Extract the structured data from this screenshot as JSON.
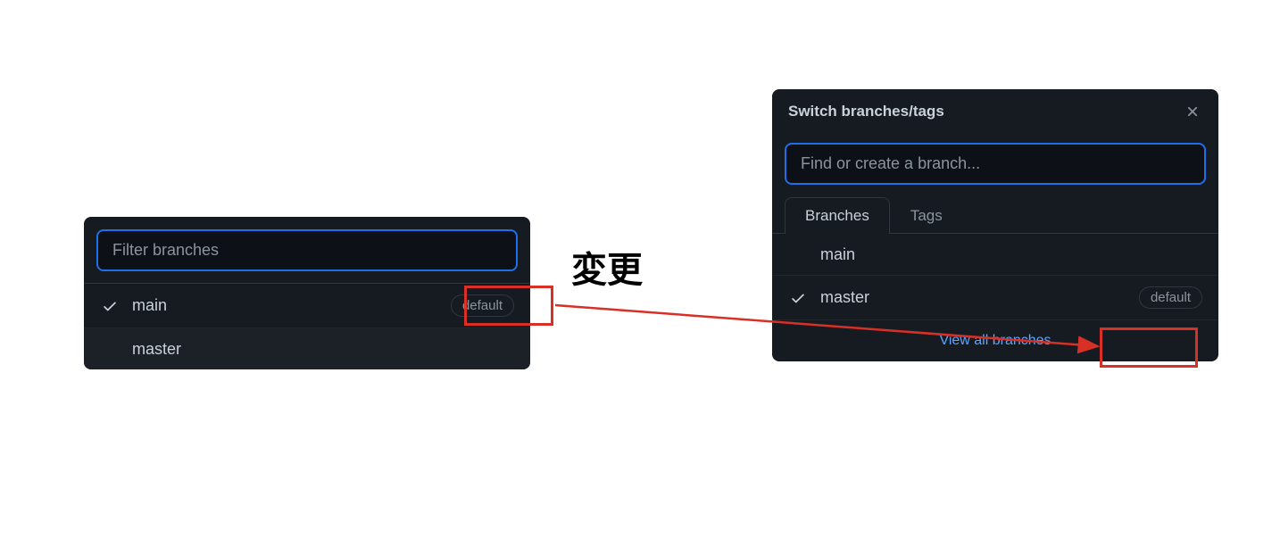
{
  "annotation": {
    "label": "変更"
  },
  "left_panel": {
    "search_placeholder": "Filter branches",
    "branches": [
      {
        "name": "main",
        "selected": true,
        "default": true
      },
      {
        "name": "master",
        "selected": false,
        "default": false
      }
    ],
    "default_label": "default"
  },
  "right_panel": {
    "title": "Switch branches/tags",
    "search_placeholder": "Find or create a branch...",
    "tabs": [
      {
        "label": "Branches",
        "active": true
      },
      {
        "label": "Tags",
        "active": false
      }
    ],
    "branches": [
      {
        "name": "main",
        "selected": false,
        "default": false
      },
      {
        "name": "master",
        "selected": true,
        "default": true
      }
    ],
    "default_label": "default",
    "view_all": "View all branches"
  }
}
